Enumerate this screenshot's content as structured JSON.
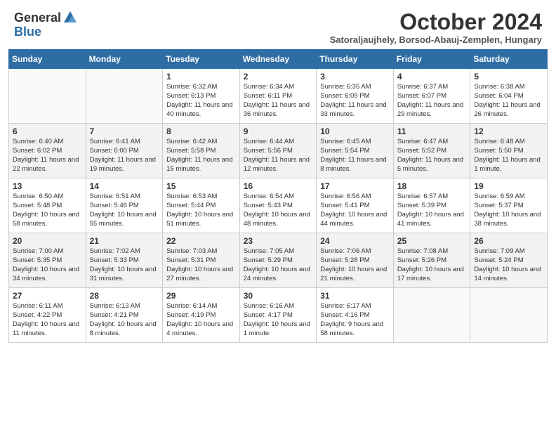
{
  "header": {
    "logo_general": "General",
    "logo_blue": "Blue",
    "month_title": "October 2024",
    "subtitle": "Satoraljaujhely, Borsod-Abauj-Zemplen, Hungary"
  },
  "weekdays": [
    "Sunday",
    "Monday",
    "Tuesday",
    "Wednesday",
    "Thursday",
    "Friday",
    "Saturday"
  ],
  "weeks": [
    [
      {
        "day": "",
        "info": ""
      },
      {
        "day": "",
        "info": ""
      },
      {
        "day": "1",
        "info": "Sunrise: 6:32 AM\nSunset: 6:13 PM\nDaylight: 11 hours and 40 minutes."
      },
      {
        "day": "2",
        "info": "Sunrise: 6:34 AM\nSunset: 6:11 PM\nDaylight: 11 hours and 36 minutes."
      },
      {
        "day": "3",
        "info": "Sunrise: 6:35 AM\nSunset: 6:09 PM\nDaylight: 11 hours and 33 minutes."
      },
      {
        "day": "4",
        "info": "Sunrise: 6:37 AM\nSunset: 6:07 PM\nDaylight: 11 hours and 29 minutes."
      },
      {
        "day": "5",
        "info": "Sunrise: 6:38 AM\nSunset: 6:04 PM\nDaylight: 11 hours and 26 minutes."
      }
    ],
    [
      {
        "day": "6",
        "info": "Sunrise: 6:40 AM\nSunset: 6:02 PM\nDaylight: 11 hours and 22 minutes."
      },
      {
        "day": "7",
        "info": "Sunrise: 6:41 AM\nSunset: 6:00 PM\nDaylight: 11 hours and 19 minutes."
      },
      {
        "day": "8",
        "info": "Sunrise: 6:42 AM\nSunset: 5:58 PM\nDaylight: 11 hours and 15 minutes."
      },
      {
        "day": "9",
        "info": "Sunrise: 6:44 AM\nSunset: 5:56 PM\nDaylight: 11 hours and 12 minutes."
      },
      {
        "day": "10",
        "info": "Sunrise: 6:45 AM\nSunset: 5:54 PM\nDaylight: 11 hours and 8 minutes."
      },
      {
        "day": "11",
        "info": "Sunrise: 6:47 AM\nSunset: 5:52 PM\nDaylight: 11 hours and 5 minutes."
      },
      {
        "day": "12",
        "info": "Sunrise: 6:48 AM\nSunset: 5:50 PM\nDaylight: 11 hours and 1 minute."
      }
    ],
    [
      {
        "day": "13",
        "info": "Sunrise: 6:50 AM\nSunset: 5:48 PM\nDaylight: 10 hours and 58 minutes."
      },
      {
        "day": "14",
        "info": "Sunrise: 6:51 AM\nSunset: 5:46 PM\nDaylight: 10 hours and 55 minutes."
      },
      {
        "day": "15",
        "info": "Sunrise: 6:53 AM\nSunset: 5:44 PM\nDaylight: 10 hours and 51 minutes."
      },
      {
        "day": "16",
        "info": "Sunrise: 6:54 AM\nSunset: 5:43 PM\nDaylight: 10 hours and 48 minutes."
      },
      {
        "day": "17",
        "info": "Sunrise: 6:56 AM\nSunset: 5:41 PM\nDaylight: 10 hours and 44 minutes."
      },
      {
        "day": "18",
        "info": "Sunrise: 6:57 AM\nSunset: 5:39 PM\nDaylight: 10 hours and 41 minutes."
      },
      {
        "day": "19",
        "info": "Sunrise: 6:59 AM\nSunset: 5:37 PM\nDaylight: 10 hours and 38 minutes."
      }
    ],
    [
      {
        "day": "20",
        "info": "Sunrise: 7:00 AM\nSunset: 5:35 PM\nDaylight: 10 hours and 34 minutes."
      },
      {
        "day": "21",
        "info": "Sunrise: 7:02 AM\nSunset: 5:33 PM\nDaylight: 10 hours and 31 minutes."
      },
      {
        "day": "22",
        "info": "Sunrise: 7:03 AM\nSunset: 5:31 PM\nDaylight: 10 hours and 27 minutes."
      },
      {
        "day": "23",
        "info": "Sunrise: 7:05 AM\nSunset: 5:29 PM\nDaylight: 10 hours and 24 minutes."
      },
      {
        "day": "24",
        "info": "Sunrise: 7:06 AM\nSunset: 5:28 PM\nDaylight: 10 hours and 21 minutes."
      },
      {
        "day": "25",
        "info": "Sunrise: 7:08 AM\nSunset: 5:26 PM\nDaylight: 10 hours and 17 minutes."
      },
      {
        "day": "26",
        "info": "Sunrise: 7:09 AM\nSunset: 5:24 PM\nDaylight: 10 hours and 14 minutes."
      }
    ],
    [
      {
        "day": "27",
        "info": "Sunrise: 6:11 AM\nSunset: 4:22 PM\nDaylight: 10 hours and 11 minutes."
      },
      {
        "day": "28",
        "info": "Sunrise: 6:13 AM\nSunset: 4:21 PM\nDaylight: 10 hours and 8 minutes."
      },
      {
        "day": "29",
        "info": "Sunrise: 6:14 AM\nSunset: 4:19 PM\nDaylight: 10 hours and 4 minutes."
      },
      {
        "day": "30",
        "info": "Sunrise: 6:16 AM\nSunset: 4:17 PM\nDaylight: 10 hours and 1 minute."
      },
      {
        "day": "31",
        "info": "Sunrise: 6:17 AM\nSunset: 4:16 PM\nDaylight: 9 hours and 58 minutes."
      },
      {
        "day": "",
        "info": ""
      },
      {
        "day": "",
        "info": ""
      }
    ]
  ]
}
